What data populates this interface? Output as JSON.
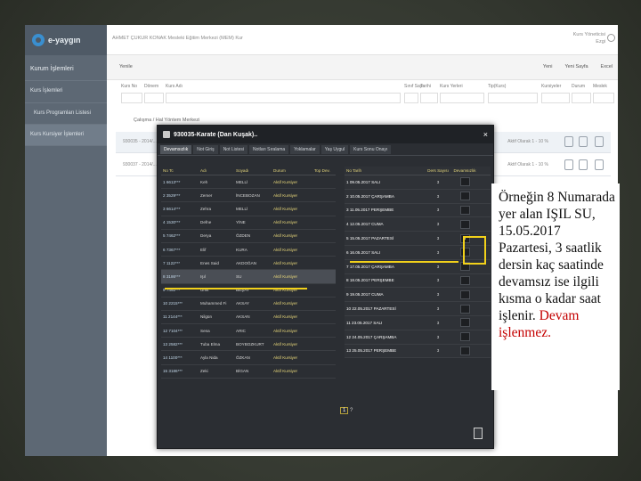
{
  "app": {
    "logo_text": "e-yaygın",
    "top_title": "AHMET ÇUKUR KONAK Mesleki Eğitim Merkezi (MEM) Kur",
    "user_line1": "Kurs Yöneticisi",
    "user_line2": "Ezgi"
  },
  "sidebar": {
    "items": [
      {
        "label": "Kurum İşlemleri"
      },
      {
        "label": "Kurs İşlemleri"
      },
      {
        "label": "Kurs Programları Listesi"
      },
      {
        "label": "Kurs Kursiyer İşlemleri"
      }
    ]
  },
  "toolbar": {
    "refresh": "Yenile",
    "yeni": "Yeni",
    "yazdir": "Yeni Sayfa",
    "excel": "Excel"
  },
  "filters": {
    "labels": [
      "Kurs No",
      "Dönem",
      "Kurs Adı",
      "Sınıf Sayı",
      "Tarihi",
      "Kurs Yerleri",
      "Tip(Kurs)",
      "Kursiyeler",
      "Durum",
      "Meslek"
    ]
  },
  "tree": {
    "label": "Çalışma / Hal Yöntem Merkezi"
  },
  "grid": {
    "rows": [
      {
        "left": "930035 - 2014/...",
        "right": "Aktif Olarak 1 - 10 %"
      },
      {
        "left": "930037 - 2014/...",
        "right": "Aktif Olarak 1 - 10 %"
      }
    ]
  },
  "modal": {
    "title": "930035-Karate (Dan Kuşak)..",
    "close": "×",
    "tabs": [
      "Devamsızlık",
      "Not Giriş",
      "Not Listesi",
      "Notları Sıralama",
      "Yoklamalar",
      "Yaş Uygul",
      "Kurs Sonu Onayı"
    ],
    "student_headers": [
      "No Tc",
      "Adı",
      "Soyadı",
      "Durum",
      "Top Dev."
    ],
    "students": [
      {
        "no": "1 6613***",
        "ad": "Keh",
        "soyad": "MELLİ",
        "durum": "Aktif Kursiyer"
      },
      {
        "no": "2 3529***",
        "ad": "Zemer",
        "soyad": "İNCEBOZAN",
        "durum": "Aktif Kursiyer"
      },
      {
        "no": "3 6614***",
        "ad": "Zehra",
        "soyad": "MELLİ",
        "durum": "Aktif Kursiyer"
      },
      {
        "no": "4 1530***",
        "ad": "Defne",
        "soyad": "YİNE",
        "durum": "Aktif Kursiyer"
      },
      {
        "no": "5 7462***",
        "ad": "Derya",
        "soyad": "ÖZDEN",
        "durum": "Aktif Kursiyer"
      },
      {
        "no": "6 7367***",
        "ad": "Elif",
        "soyad": "KURA",
        "durum": "Aktif Kursiyer"
      },
      {
        "no": "7 1122***",
        "ad": "Enes Said",
        "soyad": "AKDOĞAN",
        "durum": "Aktif Kursiyer"
      },
      {
        "no": "8 3186***",
        "ad": "Işıl",
        "soyad": "SU",
        "durum": "Aktif Kursiyer"
      },
      {
        "no": "9 7492***",
        "ad": "Ümit",
        "soyad": "BEŞAY",
        "durum": "Aktif Kursiyer"
      },
      {
        "no": "10 2215***",
        "ad": "Muhammed Fi",
        "soyad": "AKSAY",
        "durum": "Aktif Kursiyer"
      },
      {
        "no": "11 2144***",
        "ad": "Nilgün",
        "soyad": "AKSAN",
        "durum": "Aktif Kursiyer"
      },
      {
        "no": "12 7104***",
        "ad": "Sena",
        "soyad": "ARIC",
        "durum": "Aktif Kursiyer"
      },
      {
        "no": "13 2582***",
        "ad": "Tuba Elma",
        "soyad": "BOYBOZKURT",
        "durum": "Aktif Kursiyer"
      },
      {
        "no": "14 1100***",
        "ad": "Ayla Nida",
        "soyad": "ÖZKAN",
        "durum": "Aktif Kursiyer"
      },
      {
        "no": "15 3186***",
        "ad": "Zeki",
        "soyad": "BİGAN",
        "durum": "Aktif Kursiyer"
      }
    ],
    "hour_headers": [
      "No Tarih",
      "Ders Sayısı",
      "Devamsızlık"
    ],
    "hours": [
      {
        "tarih": "1 09.05.2017 SALI",
        "ders": "3",
        "dev": ""
      },
      {
        "tarih": "2 10.05.2017 ÇARŞAMBA",
        "ders": "3",
        "dev": ""
      },
      {
        "tarih": "3 11.05.2017 PERŞEMBE",
        "ders": "3",
        "dev": ""
      },
      {
        "tarih": "4 12.05.2017 CUMA",
        "ders": "3",
        "dev": ""
      },
      {
        "tarih": "5 15.05.2017 PAZARTESİ",
        "ders": "3",
        "dev": "3"
      },
      {
        "tarih": "6 16.05.2017 SALI",
        "ders": "3",
        "dev": ""
      },
      {
        "tarih": "7 17.05.2017 ÇARŞAMBA",
        "ders": "3",
        "dev": ""
      },
      {
        "tarih": "8 18.05.2017 PERŞEMBE",
        "ders": "3",
        "dev": ""
      },
      {
        "tarih": "9 19.05.2017 CUMA",
        "ders": "3",
        "dev": ""
      },
      {
        "tarih": "10 22.05.2017 PAZARTESİ",
        "ders": "3",
        "dev": ""
      },
      {
        "tarih": "11 23.05.2017 SALI",
        "ders": "3",
        "dev": ""
      },
      {
        "tarih": "12 24.05.2017 ÇARŞAMBA",
        "ders": "3",
        "dev": ""
      },
      {
        "tarih": "13 25.05.2017 PERŞEMBE",
        "ders": "3",
        "dev": ""
      }
    ],
    "pager_page": "1",
    "pager_q": "?"
  },
  "callout": {
    "text": "Örneğin 8 Numarada yer alan IŞIL SU, 15.05.2017 Pazartesi, 3 saatlik dersin kaç saatinde devamsız ise ilgili kısma o kadar saat işlenir.",
    "red_text": "Devam işlenmez."
  },
  "colors": {
    "annotation_yellow": "#f2d11a",
    "modal_bg": "#2b2e33",
    "sidebar_bg": "#5d6874",
    "callout_red": "#c40000"
  }
}
